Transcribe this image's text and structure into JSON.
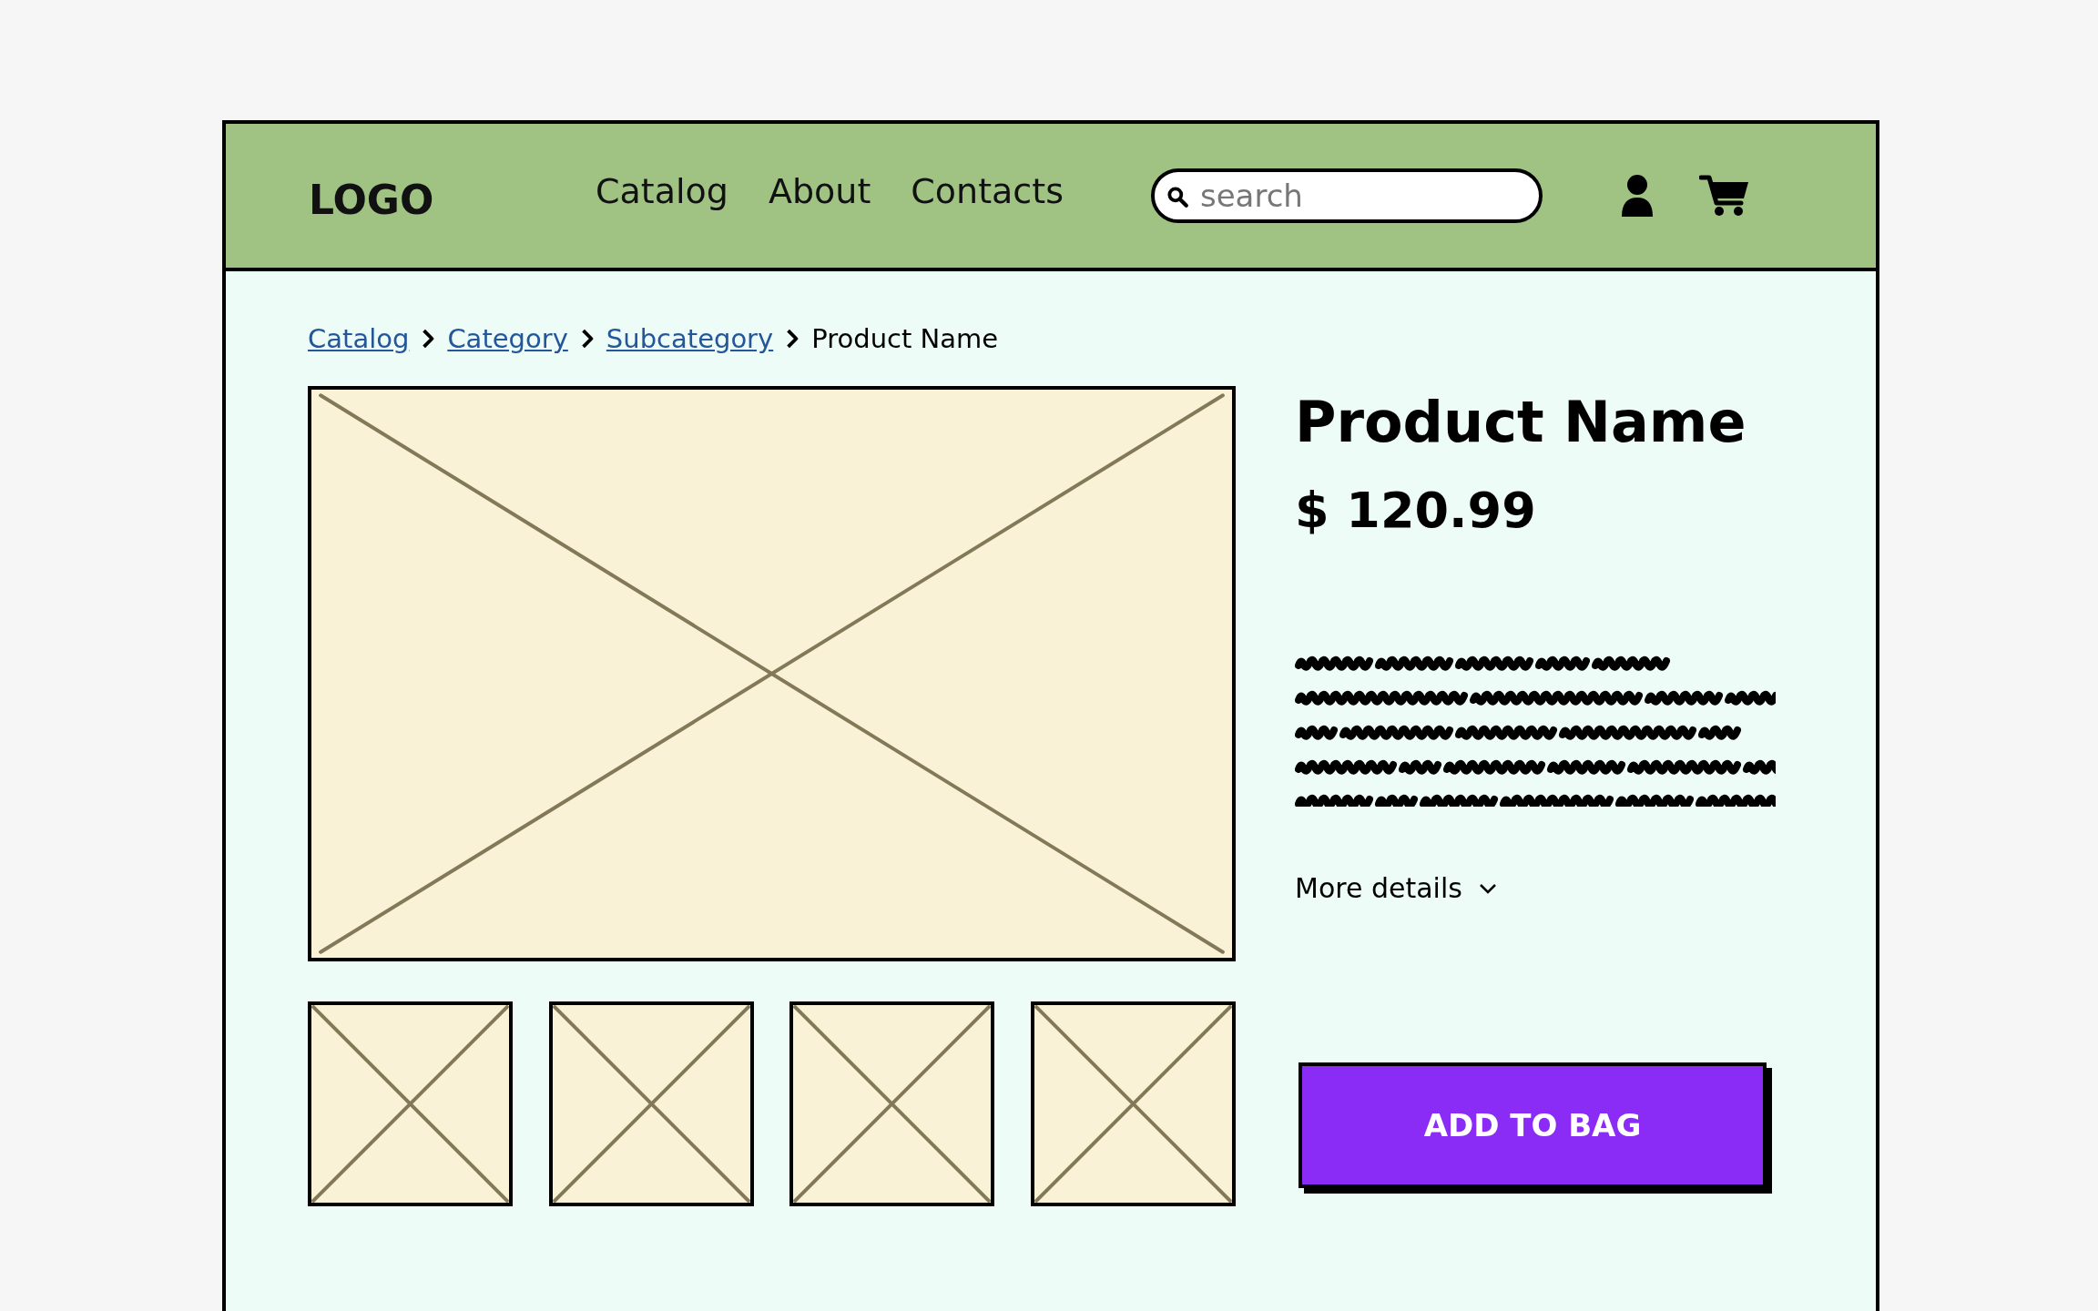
{
  "header": {
    "logo": "LOGO",
    "nav": [
      {
        "label": "Catalog"
      },
      {
        "label": "About"
      },
      {
        "label": "Contacts"
      }
    ],
    "search": {
      "placeholder": "search"
    }
  },
  "breadcrumb": [
    {
      "label": "Catalog",
      "kind": "link"
    },
    {
      "label": "Category",
      "kind": "link"
    },
    {
      "label": "Subcategory",
      "kind": "link"
    },
    {
      "label": "Product Name",
      "kind": "current"
    }
  ],
  "gallery": {
    "main": {
      "kind": "placeholder"
    },
    "thumbnails": [
      {
        "kind": "placeholder"
      },
      {
        "kind": "placeholder"
      },
      {
        "kind": "placeholder"
      },
      {
        "kind": "placeholder"
      }
    ]
  },
  "product": {
    "title": "Product Name",
    "price": "$ 120.99",
    "description": {
      "kind": "scribble"
    },
    "more_details": {
      "label": "More details",
      "expanded": false
    },
    "add_button": "ADD TO BAG"
  }
}
